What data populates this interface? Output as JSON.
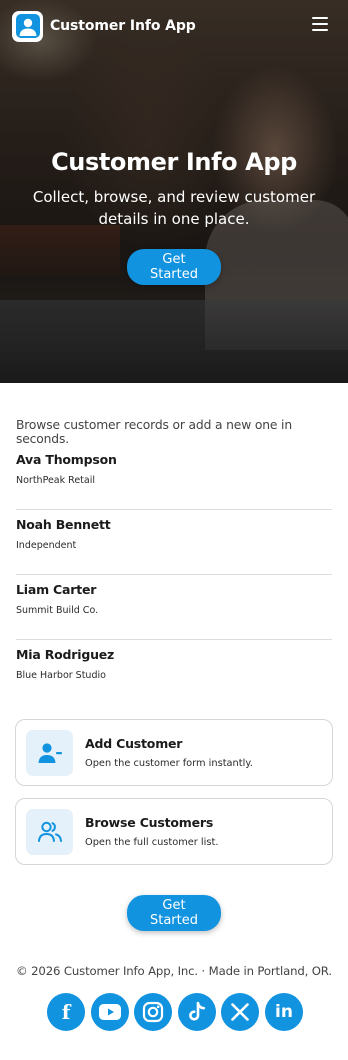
{
  "header": {
    "app_name": "Customer Info App",
    "logo_icon": "user-avatar-icon",
    "menu_icon": "hamburger-menu-icon"
  },
  "hero": {
    "title": "Customer Info App",
    "subtitle": "Collect, browse, and review customer details in one place.",
    "cta_label": "Get Started"
  },
  "main": {
    "intro": "Browse customer records or add a new one in seconds.",
    "customers": [
      {
        "name": "Ava Thompson",
        "company": "NorthPeak Retail"
      },
      {
        "name": "Noah Bennett",
        "company": "Independent"
      },
      {
        "name": "Liam Carter",
        "company": "Summit Build Co."
      },
      {
        "name": "Mia Rodriguez",
        "company": "Blue Harbor Studio"
      }
    ],
    "actions": [
      {
        "title": "Add Customer",
        "description": "Open the customer form instantly.",
        "icon": "user-minus-icon"
      },
      {
        "title": "Browse Customers",
        "description": "Open the full customer list.",
        "icon": "users-icon"
      }
    ],
    "cta_label": "Get Started"
  },
  "footer": {
    "copyright": "© 2026 Customer Info App, Inc. · Made in Portland, OR.",
    "socials": [
      "facebook-icon",
      "youtube-icon",
      "instagram-icon",
      "tiktok-icon",
      "x-icon",
      "linkedin-icon"
    ]
  },
  "colors": {
    "accent": "#1193e0",
    "icon_tile": "#e5f1fa",
    "divider": "#dcdcdc"
  }
}
